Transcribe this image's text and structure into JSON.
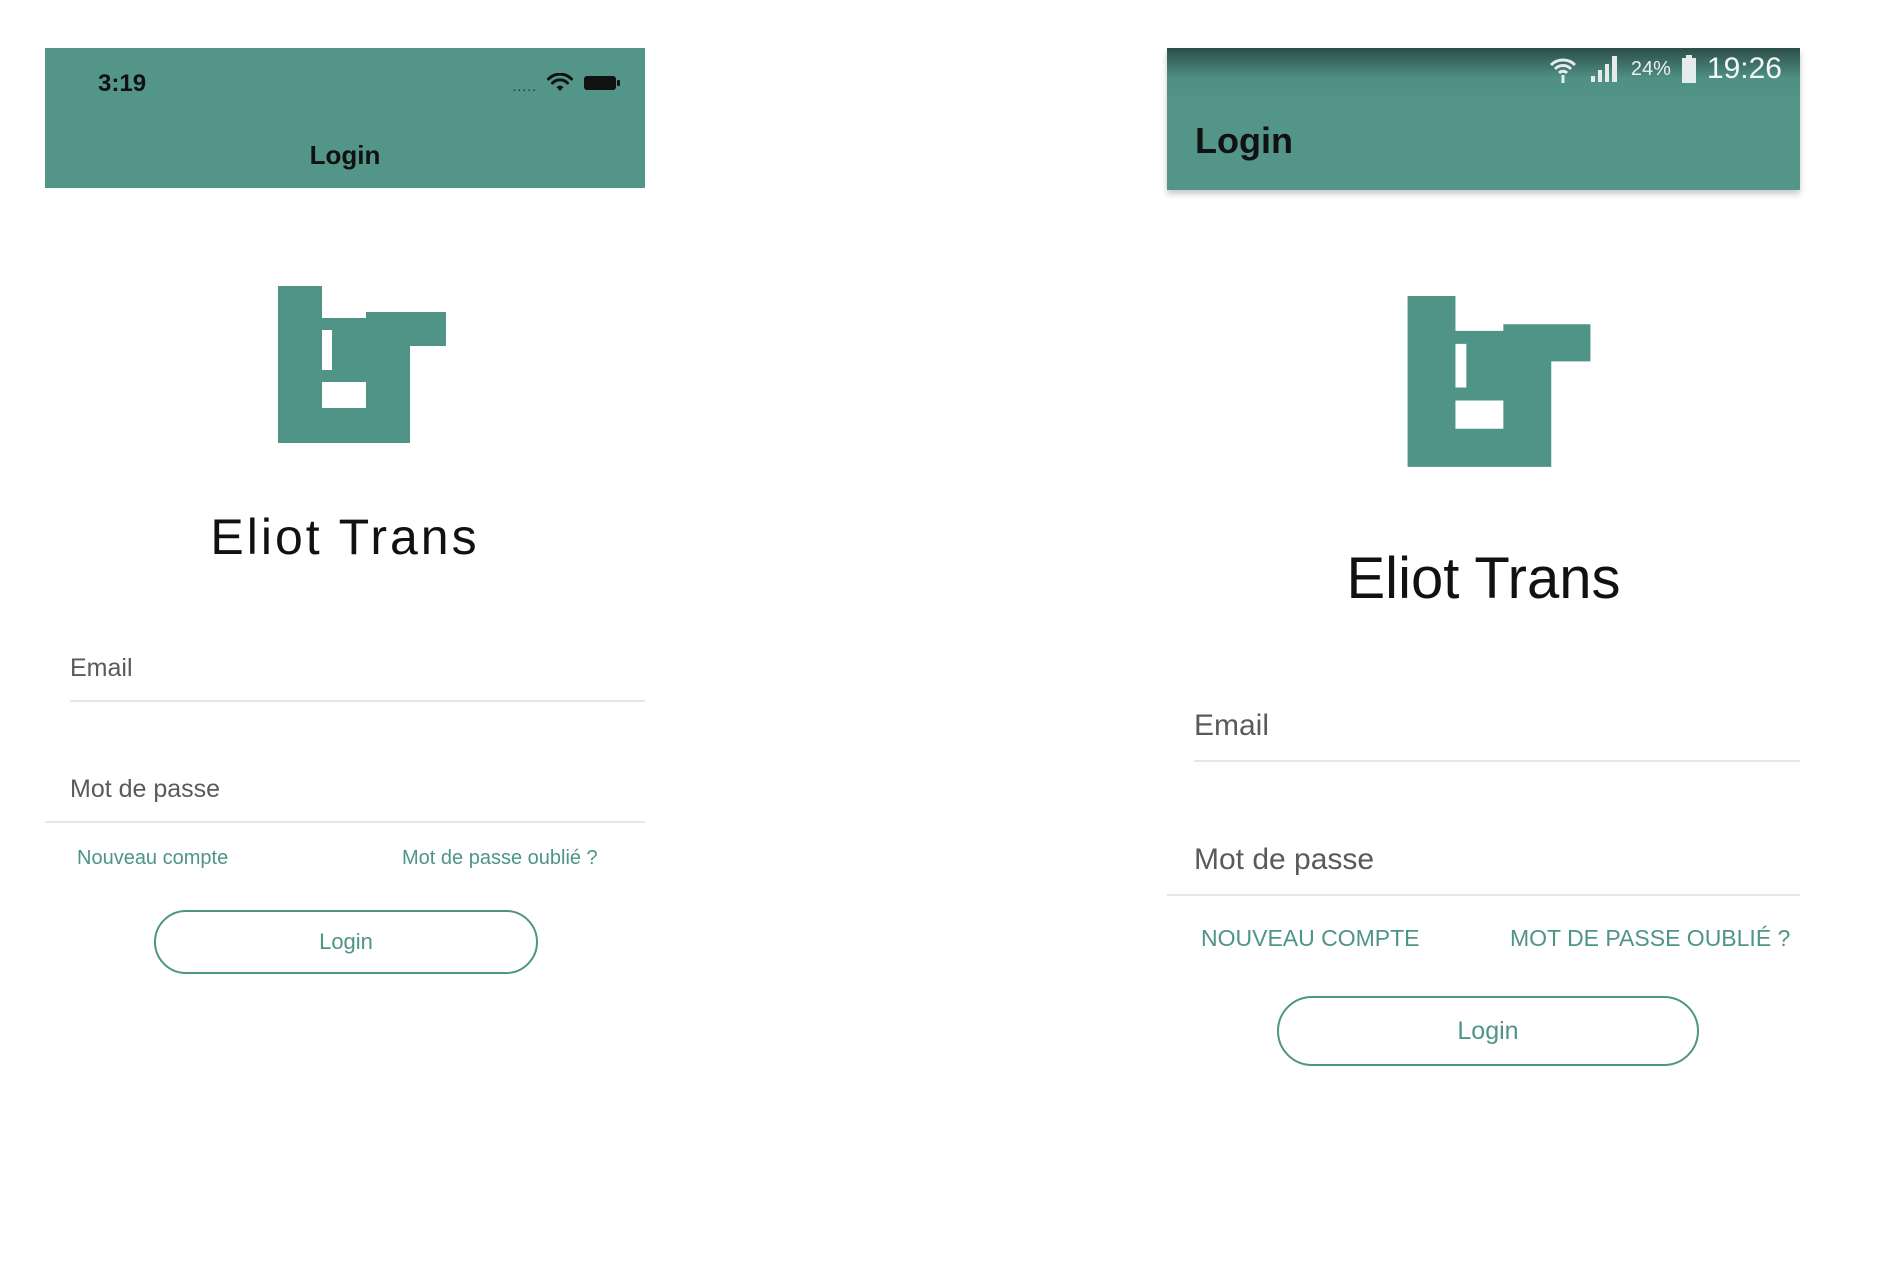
{
  "ios": {
    "status_time": "3:19",
    "signal_dots": ".....",
    "header_title": "Login",
    "brand_name": "Eliot Trans",
    "email_placeholder": "Email",
    "password_placeholder": "Mot de passe",
    "new_account_link": "Nouveau compte",
    "forgot_password_link": "Mot de passe oublié ?",
    "login_button": "Login"
  },
  "android": {
    "battery_percent": "24%",
    "status_time": "19:26",
    "header_title": "Login",
    "brand_name": "Eliot Trans",
    "email_placeholder": "Email",
    "password_placeholder": "Mot de passe",
    "new_account_link": "NOUVEAU COMPTE",
    "forgot_password_link": "MOT DE PASSE OUBLIÉ ?",
    "login_button": "Login"
  },
  "colors": {
    "accent": "#539588",
    "link": "#4e9487"
  },
  "icons": [
    "wifi-icon",
    "battery-icon",
    "cell-signal-icon",
    "eliot-trans-logo"
  ]
}
